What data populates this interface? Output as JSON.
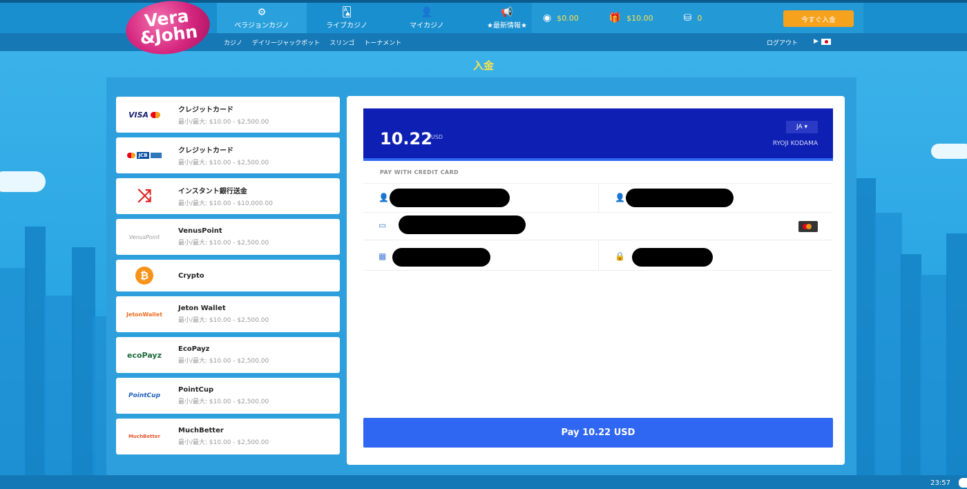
{
  "brand": {
    "logo_line1": "Vera",
    "logo_line2": "&John"
  },
  "nav": [
    {
      "label": "ベラジョンカジノ",
      "icon": "gear-icon"
    },
    {
      "label": "ライブカジノ",
      "icon": "cards-icon"
    },
    {
      "label": "マイカジノ",
      "icon": "user-icon"
    },
    {
      "label": "★最新情報★",
      "icon": "megaphone-icon"
    }
  ],
  "stats": {
    "balance": "$0.00",
    "bonus": "$10.00",
    "points": "0"
  },
  "deposit_button": "今すぐ入金",
  "subnav": [
    "カジノ",
    "デイリージャックポット",
    "スリンゴ",
    "トーナメント"
  ],
  "logout": "ログアウト",
  "page_title": "入金",
  "methods": [
    {
      "logo": "VISA",
      "name": "クレジットカード",
      "limit": "最小/最大: $10.00 - $2,500.00"
    },
    {
      "logo": "JCB",
      "name": "クレジットカード",
      "limit": "最小/最大: $10.00 - $2,500.00"
    },
    {
      "logo": "⤨",
      "name": "インスタント銀行送金",
      "limit": "最小/最大: $10.00 - $10,000.00"
    },
    {
      "logo": "VenusPoint",
      "name": "VenusPoint",
      "limit": "最小/最大: $10.00 - $2,500.00"
    },
    {
      "logo": "₿",
      "name": "Crypto",
      "limit": ""
    },
    {
      "logo": "JetonWallet",
      "name": "Jeton Wallet",
      "limit": "最小/最大: $10.00 - $2,500.00"
    },
    {
      "logo": "ecoPayz",
      "name": "EcoPayz",
      "limit": "最小/最大: $10.00 - $2,500.00"
    },
    {
      "logo": "PointCup",
      "name": "PointCup",
      "limit": "最小/最大: $10.00 - $2,500.00"
    },
    {
      "logo": "MuchBetter",
      "name": "MuchBetter",
      "limit": "最小/最大: $10.00 - $2,500.00"
    }
  ],
  "payment": {
    "amount": "10.22",
    "currency": "USD",
    "language": "JA ▾",
    "card_holder": "RYOJI KODAMA",
    "section_label": "PAY WITH CREDIT CARD",
    "pay_button": "Pay 10.22 USD"
  },
  "clock": "23:57"
}
